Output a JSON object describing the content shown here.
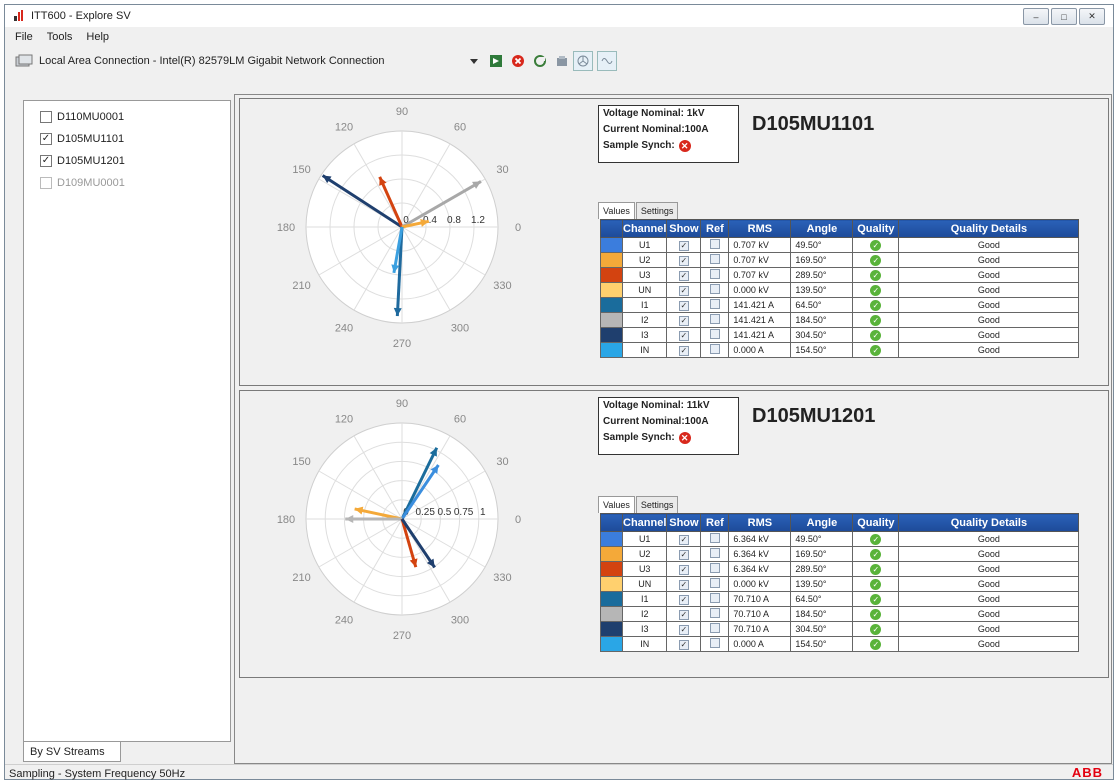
{
  "window": {
    "title": "ITT600 - Explore SV"
  },
  "menu": [
    "File",
    "Tools",
    "Help"
  ],
  "toolbar": {
    "connection": "Local Area Connection - Intel(R) 82579LM Gigabit Network Connection"
  },
  "sidebar": {
    "items": [
      {
        "label": "D110MU0001",
        "checked": false,
        "enabled": true
      },
      {
        "label": "D105MU1101",
        "checked": true,
        "enabled": true
      },
      {
        "label": "D105MU1201",
        "checked": true,
        "enabled": true
      },
      {
        "label": "D109MU0001",
        "checked": false,
        "enabled": false
      }
    ],
    "tab_label": "By SV Streams"
  },
  "statusbar": {
    "text": "Sampling -   System Frequency 50Hz",
    "logo": "ABB"
  },
  "panels": [
    {
      "name": "D105MU1101",
      "voltage_nominal": "Voltage Nominal: 1kV",
      "current_nominal": "Current Nominal:100A",
      "sample_synch": "Sample Synch:",
      "tabs": [
        "Values",
        "Settings"
      ],
      "polar": {
        "angle_labels": [
          "90",
          "60",
          "30",
          "0",
          "330",
          "300",
          "270",
          "240",
          "210",
          "180",
          "150",
          "120"
        ],
        "radial_labels": [
          "0",
          "0.4",
          "0.8",
          "1.2"
        ],
        "r_max": 1.4,
        "vectors": [
          {
            "angle": 147,
            "r": 1.38,
            "color": "#1f3f6e"
          },
          {
            "angle": 114,
            "r": 0.8,
            "color": "#d34310"
          },
          {
            "angle": 30,
            "r": 1.33,
            "color": "#a8a8a8"
          },
          {
            "angle": 12,
            "r": 0.4,
            "color": "#f4a939"
          },
          {
            "angle": 267,
            "r": 1.3,
            "color": "#1f6a9e"
          },
          {
            "angle": 260,
            "r": 0.68,
            "color": "#3ba0e0"
          }
        ]
      },
      "columns": [
        "Channel",
        "Show",
        "Ref",
        "RMS",
        "Angle",
        "Quality",
        "Quality Details"
      ],
      "rows": [
        {
          "color": "#3b7ddd",
          "channel": "U1",
          "rms": "0.707 kV",
          "angle": "49.50°",
          "details": "Good"
        },
        {
          "color": "#f4a939",
          "channel": "U2",
          "rms": "0.707 kV",
          "angle": "169.50°",
          "details": "Good"
        },
        {
          "color": "#d34310",
          "channel": "U3",
          "rms": "0.707 kV",
          "angle": "289.50°",
          "details": "Good"
        },
        {
          "color": "#ffd06e",
          "channel": "UN",
          "rms": "0.000 kV",
          "angle": "139.50°",
          "details": "Good"
        },
        {
          "color": "#1a6c9c",
          "channel": "I1",
          "rms": "141.421 A",
          "angle": "64.50°",
          "details": "Good"
        },
        {
          "color": "#b6b6b6",
          "channel": "I2",
          "rms": "141.421 A",
          "angle": "184.50°",
          "details": "Good"
        },
        {
          "color": "#1f3f6e",
          "channel": "I3",
          "rms": "141.421 A",
          "angle": "304.50°",
          "details": "Good"
        },
        {
          "color": "#2aa6e6",
          "channel": "IN",
          "rms": "0.000 A",
          "angle": "154.50°",
          "details": "Good"
        }
      ]
    },
    {
      "name": "D105MU1201",
      "voltage_nominal": "Voltage Nominal: 11kV",
      "current_nominal": "Current Nominal:100A",
      "sample_synch": "Sample Synch:",
      "tabs": [
        "Values",
        "Settings"
      ],
      "polar": {
        "angle_labels": [
          "90",
          "60",
          "30",
          "0",
          "330",
          "300",
          "270",
          "240",
          "210",
          "180",
          "150",
          "120"
        ],
        "radial_labels": [
          "0",
          "0.25",
          "0.5",
          "0.75",
          "1"
        ],
        "r_max": 1.15,
        "vectors": [
          {
            "angle": 64,
            "r": 0.95,
            "color": "#1a6c9c"
          },
          {
            "angle": 56,
            "r": 0.78,
            "color": "#3b8ede"
          },
          {
            "angle": 168,
            "r": 0.58,
            "color": "#f4a939"
          },
          {
            "angle": 180,
            "r": 0.68,
            "color": "#b6b6b6"
          },
          {
            "angle": 286,
            "r": 0.6,
            "color": "#d34310"
          },
          {
            "angle": 304,
            "r": 0.7,
            "color": "#1f3f6e"
          }
        ]
      },
      "columns": [
        "Channel",
        "Show",
        "Ref",
        "RMS",
        "Angle",
        "Quality",
        "Quality Details"
      ],
      "rows": [
        {
          "color": "#3b7ddd",
          "channel": "U1",
          "rms": "6.364 kV",
          "angle": "49.50°",
          "details": "Good"
        },
        {
          "color": "#f4a939",
          "channel": "U2",
          "rms": "6.364 kV",
          "angle": "169.50°",
          "details": "Good"
        },
        {
          "color": "#d34310",
          "channel": "U3",
          "rms": "6.364 kV",
          "angle": "289.50°",
          "details": "Good"
        },
        {
          "color": "#ffd06e",
          "channel": "UN",
          "rms": "0.000 kV",
          "angle": "139.50°",
          "details": "Good"
        },
        {
          "color": "#1a6c9c",
          "channel": "I1",
          "rms": "70.710 A",
          "angle": "64.50°",
          "details": "Good"
        },
        {
          "color": "#b6b6b6",
          "channel": "I2",
          "rms": "70.710 A",
          "angle": "184.50°",
          "details": "Good"
        },
        {
          "color": "#1f3f6e",
          "channel": "I3",
          "rms": "70.710 A",
          "angle": "304.50°",
          "details": "Good"
        },
        {
          "color": "#2aa6e6",
          "channel": "IN",
          "rms": "0.000 A",
          "angle": "154.50°",
          "details": "Good"
        }
      ]
    }
  ]
}
